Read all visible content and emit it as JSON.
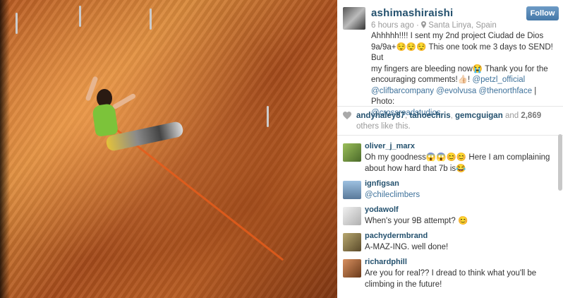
{
  "post": {
    "username": "ashimashiraishi",
    "follow_label": "Follow",
    "time": "6 hours ago",
    "separator": "·",
    "location_icon": "location-pin-icon",
    "location": "Santa Linya, Spain",
    "caption_lines": [
      "Ahhhhh!!!! I sent my 2nd project Ciudad de Dios",
      "9a/9a+😌😌😌 This one took me 3 days to SEND! But",
      "my fingers are bleeding now😭 Thank you for the",
      "encouraging comments!👍🏻! "
    ],
    "caption_mentions": {
      "petzl": "@petzl_official",
      "clifbar": "@clifbarcompany",
      "evolv": "@evolvusa",
      "tnf": "@thenorthface",
      "photo_label": " | Photo:",
      "crossroads": "@crossroadstudios"
    }
  },
  "likes": {
    "icon": "heart-icon",
    "users": [
      "andyhaley87",
      "tahoechris",
      "gemcguigan"
    ],
    "and_text": "and",
    "count": "2,869",
    "others_text": "others like this."
  },
  "comments": [
    {
      "user": "oliver_j_marx",
      "text": "Oh my goodness😱😱😊😊 Here I am complaining about how hard that 7b is😂",
      "avatar_color": "#6a8a3a"
    },
    {
      "user": "ignfigsan",
      "text": "@chileclimbers",
      "is_link": true,
      "avatar_color": "#7aa0c8"
    },
    {
      "user": "yodawolf",
      "text": "When's your 9B attempt? 😊",
      "avatar_color": "#d8d8d8"
    },
    {
      "user": "pachydermbrand",
      "text": "A-MAZ-ING. well done!",
      "avatar_color": "#8a7a4a"
    },
    {
      "user": "richardphill",
      "text": "Are you for real?? I dread to think what you'll be climbing in the future!",
      "avatar_color": "#b07040"
    }
  ]
}
